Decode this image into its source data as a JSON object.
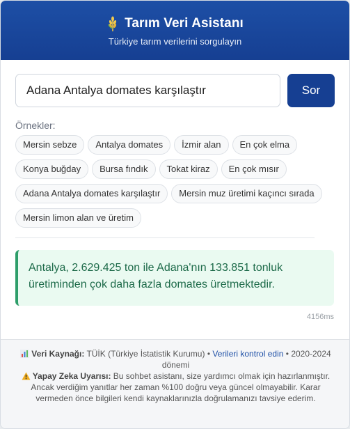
{
  "header": {
    "icon": "wheat-icon",
    "title": "Tarım Veri Asistanı",
    "subtitle": "Türkiye tarım verilerini sorgulayın"
  },
  "search": {
    "value": "Adana Antalya domates karşılaştır",
    "button_label": "Sor"
  },
  "examples": {
    "label": "Örnekler:",
    "items": [
      "Mersin sebze",
      "Antalya domates",
      "İzmir alan",
      "En çok elma",
      "Konya buğday",
      "Bursa fındık",
      "Tokat kiraz",
      "En çok mısır",
      "Adana Antalya domates karşılaştır",
      "Mersin muz üretimi kaçıncı sırada",
      "Mersin limon alan ve üretim"
    ]
  },
  "answer": {
    "text": "Antalya, 2.629.425 ton ile Adana'nın 133.851 tonluk üretiminden çok daha fazla domates üretmektedir.",
    "timing": "4156ms"
  },
  "footer": {
    "source_icon": "bar-chart-icon",
    "source_label": "Veri Kaynağı:",
    "source_text": "TÜİK (Türkiye İstatistik Kurumu)",
    "separator": "•",
    "verify_link": "Verileri kontrol edin",
    "period": "2020-2024 dönemi",
    "warning_icon": "warning-icon",
    "warning_label": "Yapay Zeka Uyarısı:",
    "warning_text": "Bu sohbet asistanı, size yardımcı olmak için hazırlanmıştır. Ancak verdiğim yanıtlar her zaman %100 doğru veya güncel olmayabilir. Karar vermeden önce bilgileri kendi kaynaklarınızla doğrulamanızı tavsiye ederim."
  },
  "colors": {
    "header_bg": "#1d4fa6",
    "button_bg": "#163f92",
    "answer_bg": "#eafaf1",
    "answer_border": "#2e9e6a",
    "answer_text": "#1e6b4a",
    "link": "#1d4fa6"
  }
}
